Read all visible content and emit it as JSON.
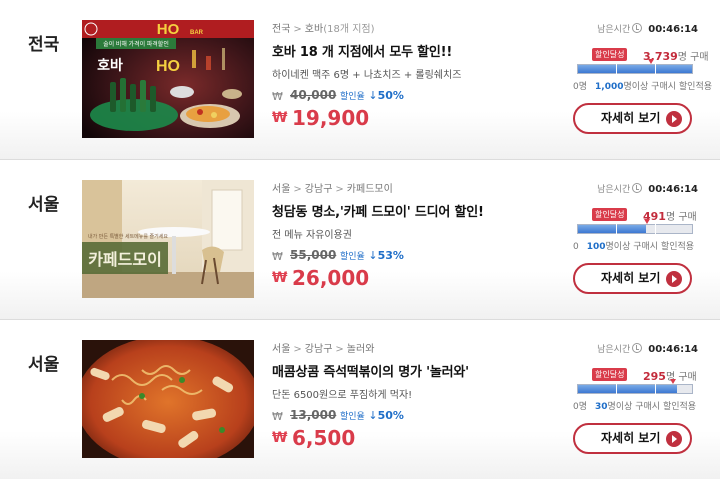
{
  "deals": [
    {
      "region": "전국",
      "breadcrumb": [
        "전국",
        "호바"
      ],
      "branch_count": "(18개 지점)",
      "title": "호바 18 개 지점에서 모두 할인!!",
      "desc": "하이네켄 맥주 6명 + 나쵸치즈 + 롤링쉐치즈",
      "currency": "₩",
      "original_price": "40,000",
      "discount_label": "할인율",
      "discount": "50%",
      "sale_price": "19,900",
      "remaining_label": "남은시간",
      "remaining_time": "00:46:14",
      "badge": "할인달성",
      "sold_count": "3,739",
      "sold_suffix": "명 구매",
      "progress_fraction": 1.0,
      "scale_zero": "0명",
      "min_buyers": "1,000",
      "min_suffix": "명이상 구매시 할인적용",
      "button": "자세히 보기"
    },
    {
      "region": "서울",
      "breadcrumb": [
        "서울",
        "강남구",
        "카페드모이"
      ],
      "branch_count": "",
      "title": "청담동 명소,'카페 드모이' 드디어 할인!",
      "desc": "전 메뉴 자유이용권",
      "currency": "₩",
      "original_price": "55,000",
      "discount_label": "할인율",
      "discount": "53%",
      "sale_price": "26,000",
      "remaining_label": "남은시간",
      "remaining_time": "00:46:14",
      "badge": "할인달성",
      "sold_count": "491",
      "sold_suffix": "명 구매",
      "progress_fraction": 0.6,
      "scale_zero": "0",
      "min_buyers": "100",
      "min_suffix": "명이상 구매시 할인적용",
      "button": "자세히 보기"
    },
    {
      "region": "서울",
      "breadcrumb": [
        "서울",
        "강남구",
        "놀러와"
      ],
      "branch_count": "",
      "title": "매콤상콤 즉석떡볶이의 명가 '놀러와'",
      "desc": "단돈 6500원으로 푸짐하게 먹자!",
      "currency": "₩",
      "original_price": "13,000",
      "discount_label": "할인율",
      "discount": "50%",
      "sale_price": "6,500",
      "remaining_label": "남은시간",
      "remaining_time": "00:46:14",
      "badge": "할인달성",
      "sold_count": "295",
      "sold_suffix": "명 구매",
      "progress_fraction": 0.87,
      "scale_zero": "0명",
      "min_buyers": "30",
      "min_suffix": "명이상 구매시 할인적용",
      "button": "자세히 보기"
    }
  ],
  "images": {
    "deal1": {
      "sign": "호바",
      "sign_logo": "HO",
      "sign_bar": "BAR",
      "banner": "술이 비해 가격이 파격할인"
    },
    "deal2": {
      "sign": "카페드모이",
      "caption": "내가 만든 특별한 세트메뉴를 즐기세요"
    },
    "deal3": {}
  },
  "colors": {
    "accent": "#d93b4a",
    "discount_blue": "#1f6ec8",
    "bar_blue": "#3c78d2"
  }
}
